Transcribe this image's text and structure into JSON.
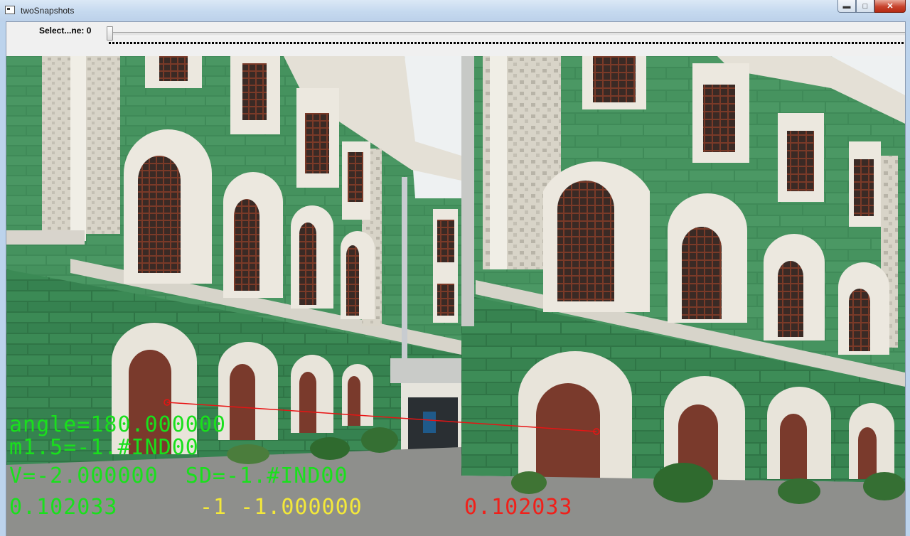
{
  "window": {
    "title": "twoSnapshots",
    "minimize_label": "▬",
    "maximize_label": "□",
    "close_label": "✕"
  },
  "trackbar": {
    "label": "Select...ne: 0",
    "value": 0
  },
  "overlay": {
    "line1": "angle=180.000000",
    "line2": "m1.5=-1.#IND00",
    "line3": "V=-2.000000  SD=-1.#IND00",
    "line4a": "0.102033",
    "line4b": "-1 -1.000000",
    "line4c": "0.102033"
  },
  "colors": {
    "overlay_green": "#19e01c",
    "overlay_yellow": "#f3e83a",
    "overlay_red": "#f0201a",
    "facade": "#3e8a57",
    "trim": "#ece8df",
    "window_frame": "#7a3a28"
  }
}
